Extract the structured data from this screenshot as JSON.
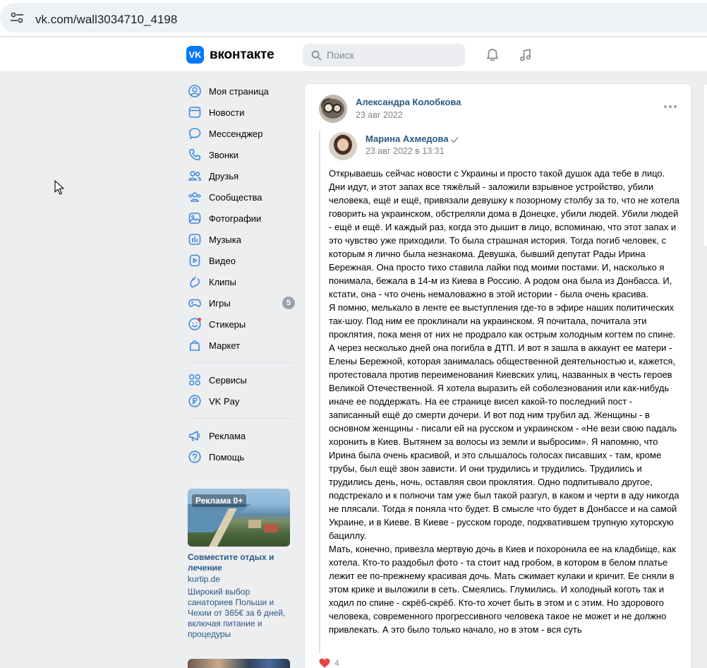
{
  "browser": {
    "url": "vk.com/wall3034710_4198"
  },
  "header": {
    "logo_letters": "VK",
    "logo_text": "вконтакте",
    "search_placeholder": "Поиск",
    "icons": [
      "bell-icon",
      "music-icon"
    ]
  },
  "sidebar": {
    "items": [
      {
        "label": "Моя страница",
        "icon": "user-icon"
      },
      {
        "label": "Новости",
        "icon": "news-icon"
      },
      {
        "label": "Мессенджер",
        "icon": "chat-icon"
      },
      {
        "label": "Звонки",
        "icon": "phone-icon"
      },
      {
        "label": "Друзья",
        "icon": "friends-icon"
      },
      {
        "label": "Сообщества",
        "icon": "communities-icon"
      },
      {
        "label": "Фотографии",
        "icon": "photo-icon"
      },
      {
        "label": "Музыка",
        "icon": "music-icon"
      },
      {
        "label": "Видео",
        "icon": "video-icon"
      },
      {
        "label": "Клипы",
        "icon": "clips-icon"
      },
      {
        "label": "Игры",
        "icon": "gamepad-icon",
        "badge": "5"
      },
      {
        "label": "Стикеры",
        "icon": "sticker-icon"
      },
      {
        "label": "Маркет",
        "icon": "market-icon"
      }
    ],
    "services": [
      {
        "label": "Сервисы",
        "icon": "services-icon"
      },
      {
        "label": "VK Pay",
        "icon": "vkpay-icon"
      }
    ],
    "misc": [
      {
        "label": "Реклама",
        "icon": "megaphone-icon"
      },
      {
        "label": "Помощь",
        "icon": "help-icon"
      }
    ],
    "ad": {
      "tag": "Реклама 0+",
      "title": "Совместите отдых и лечение",
      "domain": "kurtip.de",
      "description": "Широкий выбор санаториев Польши и Чехии от 365€ за 6 дней, включая питание и процедуры"
    }
  },
  "post": {
    "author": "Александра Колобкова",
    "date": "23 авг 2022",
    "repost": {
      "author": "Марина Ахмедова",
      "date": "23 авг 2022 в 13:31",
      "paragraphs": [
        "Открываешь сейчас новости с Украины и просто такой душок ада тебе в лицо. Дни идут, и этот запах все тяжёлый - заложили взрывное устройство, убили человека, ещё и ещё, привязали девушку к позорному столбу за то, что не хотела говорить на украинском, обстреляли дома в Донецке, убили людей. Убили людей - ещё и ещё. И каждый раз, когда это дышит в лицо, вспоминаю, что этот запах и это чувство уже приходили. То была страшная история. Тогда погиб человек, с которым я лично была незнакома. Девушка, бывший депутат Рады Ирина Бережная. Она просто тихо ставила лайки под моими постами. И, насколько я понимала, бежала в 14-м из Киева в Россию. А родом она была из Донбасса. И, кстати, она - что очень немаловажно в этой истории - была очень красива.",
        "Я помню, мелькало в ленте ее выступления где-то в эфире наших политических так-шоу. Под ним ее проклинали на украинском. Я почитала, почитала эти проклятия, пока меня от них не продрало как острым холодным когтем по спине. А через несколько дней она погибла в ДТП. И вот я зашла в аккаунт ее матери - Елены Бережной, которая занималась общественной деятельностью и, кажется, протестовала против переименования Киевских улиц, названных в честь героев Великой Отечественной. Я хотела выразить ей соболезнования или как-нибудь иначе ее поддержать. На ее странице висел какой-то последний пост - записанный ещё до смерти дочери. И вот под ним трубил ад. Женщины - в основном женщины - писали ей на русском и украинском - «Не вези свою падаль хоронить в Киев. Вытянем за волосы из земли и выбросим». Я напомню, что Ирина была очень красивой, и это слышалось голосах писавших - там, кроме трубы, был ещё звон зависти. И они трудились и трудились. Трудились и трудились день, ночь, оставляя свои проклятия. Одно подпитывало другое, подстрекало и к полночи там уже был такой разгул, в каком и черти в аду никогда не плясали. Тогда я поняла что будет. В смысле что будет в Донбассе и на самой Украине, и в Киеве. В Киеве - русском городе, подхватившем трупную хуторскую бациллу.",
        "Мать, конечно, привезла мертвую дочь в Киев и похоронила ее на кладбище, как хотела. Кто-то раздобыл фото - та стоит над гробом, в котором в белом платье лежит ее по-прежнему красивая дочь. Мать сжимает кулаки и кричит. Ее сняли в этом крике и выложили в сеть. Смеялись. Глумились. И холодный коготь так и ходил по спине - скрёб-скрёб. Кто-то хочет быть в этом и с этим. Но здорового человека, современного прогрессивного человека такое не может и не должно привлекать. А это было только начало, но в этом - вся суть"
      ]
    },
    "likes": "4"
  },
  "colors": {
    "accent": "#0077ff",
    "link": "#2a5885",
    "background": "#edeef0",
    "like": "#e64646"
  }
}
